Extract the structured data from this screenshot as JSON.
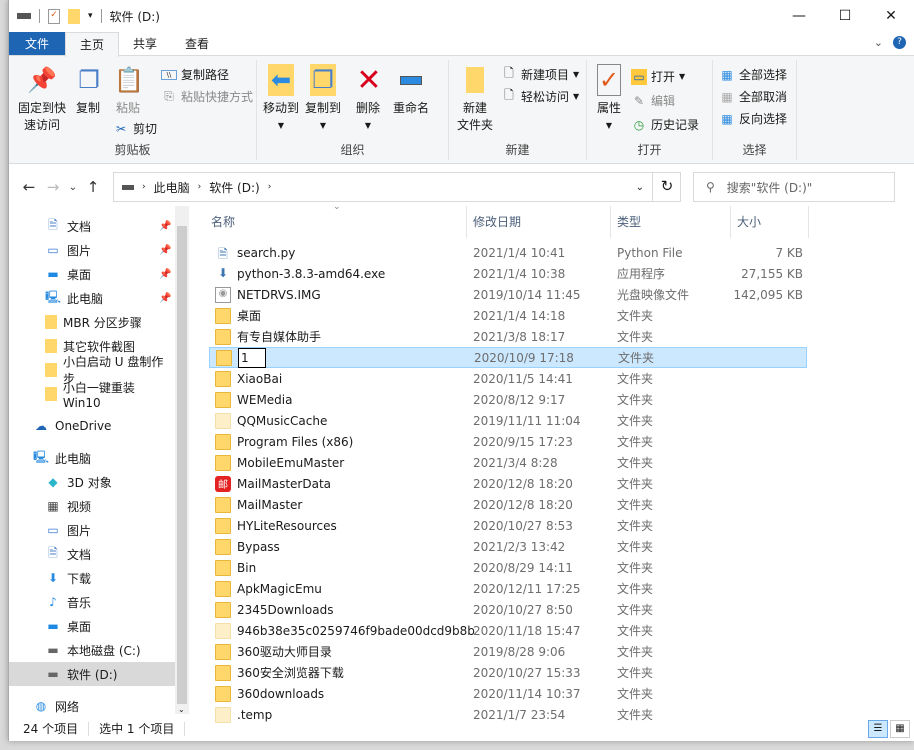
{
  "window": {
    "title": "软件 (D:)",
    "minimize": "—",
    "maximize": "☐",
    "close": "✕"
  },
  "tabs": [
    {
      "label": "文件"
    },
    {
      "label": "主页"
    },
    {
      "label": "共享"
    },
    {
      "label": "查看"
    }
  ],
  "ribbon": {
    "clipboard": {
      "label": "剪贴板",
      "pin": "固定到快速访问",
      "pin_l1": "固定到快",
      "pin_l2": "速访问",
      "copy": "复制",
      "paste": "粘贴",
      "copy_path": "复制路径",
      "paste_shortcut": "粘贴快捷方式",
      "cut": "剪切"
    },
    "organize": {
      "label": "组织",
      "move_to": "移动到",
      "copy_to": "复制到",
      "delete": "删除",
      "rename": "重命名"
    },
    "new": {
      "label": "新建",
      "new_folder_l1": "新建",
      "new_folder_l2": "文件夹",
      "new_item": "新建项目",
      "easy_access": "轻松访问"
    },
    "open": {
      "label": "打开",
      "properties": "属性",
      "open": "打开",
      "edit": "编辑",
      "history": "历史记录"
    },
    "select": {
      "label": "选择",
      "select_all": "全部选择",
      "select_none": "全部取消",
      "invert": "反向选择"
    }
  },
  "address": {
    "crumbs": [
      "此电脑",
      "软件 (D:)"
    ],
    "search_placeholder": "搜索\"软件 (D:)\""
  },
  "nav": [
    {
      "label": "文档",
      "icon": "document-icon",
      "pinned": true
    },
    {
      "label": "图片",
      "icon": "pictures-icon",
      "pinned": true
    },
    {
      "label": "桌面",
      "icon": "desktop-icon",
      "pinned": true
    },
    {
      "label": "此电脑",
      "icon": "pc-icon",
      "pinned": true
    },
    {
      "label": "MBR 分区步骤",
      "icon": "folder-icon"
    },
    {
      "label": "其它软件截图",
      "icon": "folder-icon"
    },
    {
      "label": "小白启动 U 盘制作步",
      "icon": "folder-icon"
    },
    {
      "label": "小白一键重装 Win10",
      "icon": "folder-icon"
    },
    {
      "label": "OneDrive",
      "icon": "onedrive-icon"
    },
    {
      "label": "此电脑",
      "icon": "pc-icon"
    },
    {
      "label": "3D 对象",
      "icon": "3d-objects-icon"
    },
    {
      "label": "视频",
      "icon": "video-icon"
    },
    {
      "label": "图片",
      "icon": "pictures-icon"
    },
    {
      "label": "文档",
      "icon": "document-icon"
    },
    {
      "label": "下载",
      "icon": "download-icon"
    },
    {
      "label": "音乐",
      "icon": "music-icon"
    },
    {
      "label": "桌面",
      "icon": "desktop-icon"
    },
    {
      "label": "本地磁盘 (C:)",
      "icon": "drive-icon"
    },
    {
      "label": "软件 (D:)",
      "icon": "drive-icon",
      "selected": true
    },
    {
      "label": "网络",
      "icon": "network-icon"
    }
  ],
  "columns": [
    "名称",
    "修改日期",
    "类型",
    "大小"
  ],
  "files": [
    {
      "name": "search.py",
      "date": "2021/1/4 10:41",
      "type": "Python File",
      "size": "7 KB",
      "icon": "python-file-icon"
    },
    {
      "name": "python-3.8.3-amd64.exe",
      "date": "2021/1/4 10:38",
      "type": "应用程序",
      "size": "27,155 KB",
      "icon": "installer-icon"
    },
    {
      "name": "NETDRVS.IMG",
      "date": "2019/10/14 11:45",
      "type": "光盘映像文件",
      "size": "142,095 KB",
      "icon": "disc-image-icon"
    },
    {
      "name": "桌面",
      "date": "2021/1/4 14:18",
      "type": "文件夹",
      "icon": "folder-icon"
    },
    {
      "name": "有专自媒体助手",
      "date": "2021/3/8 18:17",
      "type": "文件夹",
      "icon": "folder-icon"
    },
    {
      "name": "1",
      "date": "2020/10/9 17:18",
      "type": "文件夹",
      "icon": "folder-icon",
      "selected": true,
      "editing": true
    },
    {
      "name": "XiaoBai",
      "date": "2020/11/5 14:41",
      "type": "文件夹",
      "icon": "folder-icon"
    },
    {
      "name": "WEMedia",
      "date": "2020/8/12 9:17",
      "type": "文件夹",
      "icon": "folder-icon"
    },
    {
      "name": "QQMusicCache",
      "date": "2019/11/11 11:04",
      "type": "文件夹",
      "icon": "hidden-folder-icon"
    },
    {
      "name": "Program Files (x86)",
      "date": "2020/9/15 17:23",
      "type": "文件夹",
      "icon": "folder-icon"
    },
    {
      "name": "MobileEmuMaster",
      "date": "2021/3/4 8:28",
      "type": "文件夹",
      "icon": "folder-icon"
    },
    {
      "name": "MailMasterData",
      "date": "2020/12/8 18:20",
      "type": "文件夹",
      "icon": "mailmaster-icon"
    },
    {
      "name": "MailMaster",
      "date": "2020/12/8 18:20",
      "type": "文件夹",
      "icon": "folder-icon"
    },
    {
      "name": "HYLiteResources",
      "date": "2020/10/27 8:53",
      "type": "文件夹",
      "icon": "folder-icon"
    },
    {
      "name": "Bypass",
      "date": "2021/2/3 13:42",
      "type": "文件夹",
      "icon": "folder-icon"
    },
    {
      "name": "Bin",
      "date": "2020/8/29 14:11",
      "type": "文件夹",
      "icon": "folder-icon"
    },
    {
      "name": "ApkMagicEmu",
      "date": "2020/12/11 17:25",
      "type": "文件夹",
      "icon": "folder-icon"
    },
    {
      "name": "2345Downloads",
      "date": "2020/10/27 8:50",
      "type": "文件夹",
      "icon": "folder-icon"
    },
    {
      "name": "946b38e35c0259746f9bade00dcd9b8b",
      "date": "2020/11/18 15:47",
      "type": "文件夹",
      "icon": "hidden-folder-icon"
    },
    {
      "name": "360驱动大师目录",
      "date": "2019/8/28 9:06",
      "type": "文件夹",
      "icon": "folder-icon"
    },
    {
      "name": "360安全浏览器下载",
      "date": "2020/10/27 15:33",
      "type": "文件夹",
      "icon": "folder-icon"
    },
    {
      "name": "360downloads",
      "date": "2020/11/14 10:37",
      "type": "文件夹",
      "icon": "folder-icon"
    },
    {
      "name": ".temp",
      "date": "2021/1/7 23:54",
      "type": "文件夹",
      "icon": "hidden-folder-icon"
    }
  ],
  "status": {
    "count": "24 个项目",
    "selected": "选中 1 个项目"
  },
  "colors": {
    "accent": "#1e65b3",
    "selection": "#cce8ff",
    "folder": "#ffd76a"
  }
}
